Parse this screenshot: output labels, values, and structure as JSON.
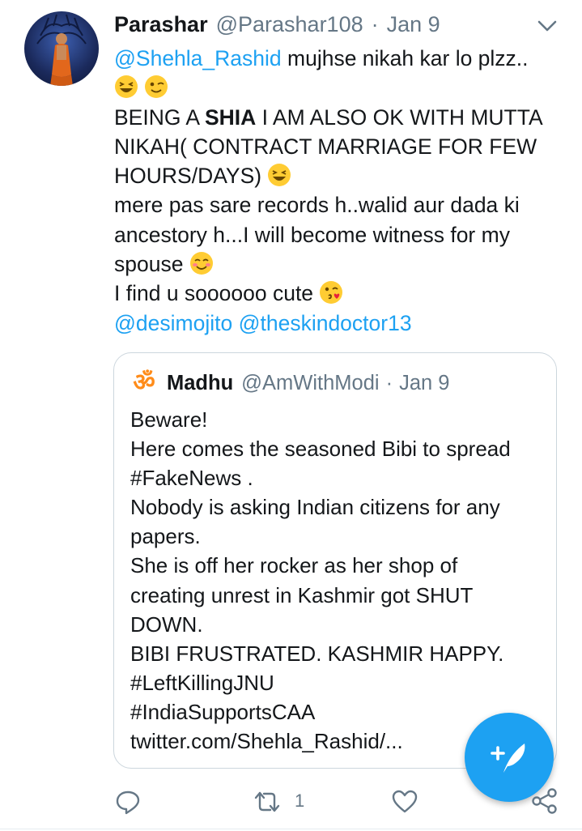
{
  "tweet": {
    "display_name": "Parashar",
    "handle": "@Parashar108",
    "separator": "·",
    "date": "Jan 9",
    "reply_to": "@Shehla_Rashid",
    "line1_text": " mujhse nikah kar lo plzz..",
    "line3_pre": "BEING A ",
    "line3_bold": "SHIA",
    "line3_post": " I AM ALSO OK WITH MUTTA",
    "line4": "NIKAH( CONTRACT MARRIAGE FOR FEW",
    "line5": "HOURS/DAYS)",
    "line6": "mere pas sare records h..walid aur  dada ki",
    "line7": "ancestory h...I will become witness for my",
    "line8": "spouse",
    "line9": "I find u soooooo cute",
    "mention1": "@desimojito",
    "mention2": "@theskindoctor13"
  },
  "quoted": {
    "avatar_glyph": "ॐ",
    "display_name": "Madhu",
    "handle": "@AmWithModi",
    "separator": "·",
    "date": "Jan 9",
    "lines": [
      "Beware!",
      "Here comes the seasoned Bibi to spread",
      "#FakeNews .",
      "Nobody is asking Indian citizens for any",
      "papers.",
      "She is off her rocker as her shop of",
      "creating unrest in Kashmir got SHUT",
      "DOWN.",
      "BIBI FRUSTRATED. KASHMIR HAPPY.",
      "#LeftKillingJNU",
      "#IndiaSupportsCAA",
      "twitter.com/Shehla_Rashid/..."
    ]
  },
  "actions": {
    "retweet_count": "1"
  },
  "icons": {
    "more": "chevron-down-icon",
    "reply": "reply-icon",
    "retweet": "retweet-icon",
    "like": "heart-icon",
    "share": "share-icon",
    "compose": "compose-tweet-icon"
  },
  "colors": {
    "accent": "#1da1f2",
    "secondary_text": "#657786",
    "border": "#ccd6dd"
  }
}
